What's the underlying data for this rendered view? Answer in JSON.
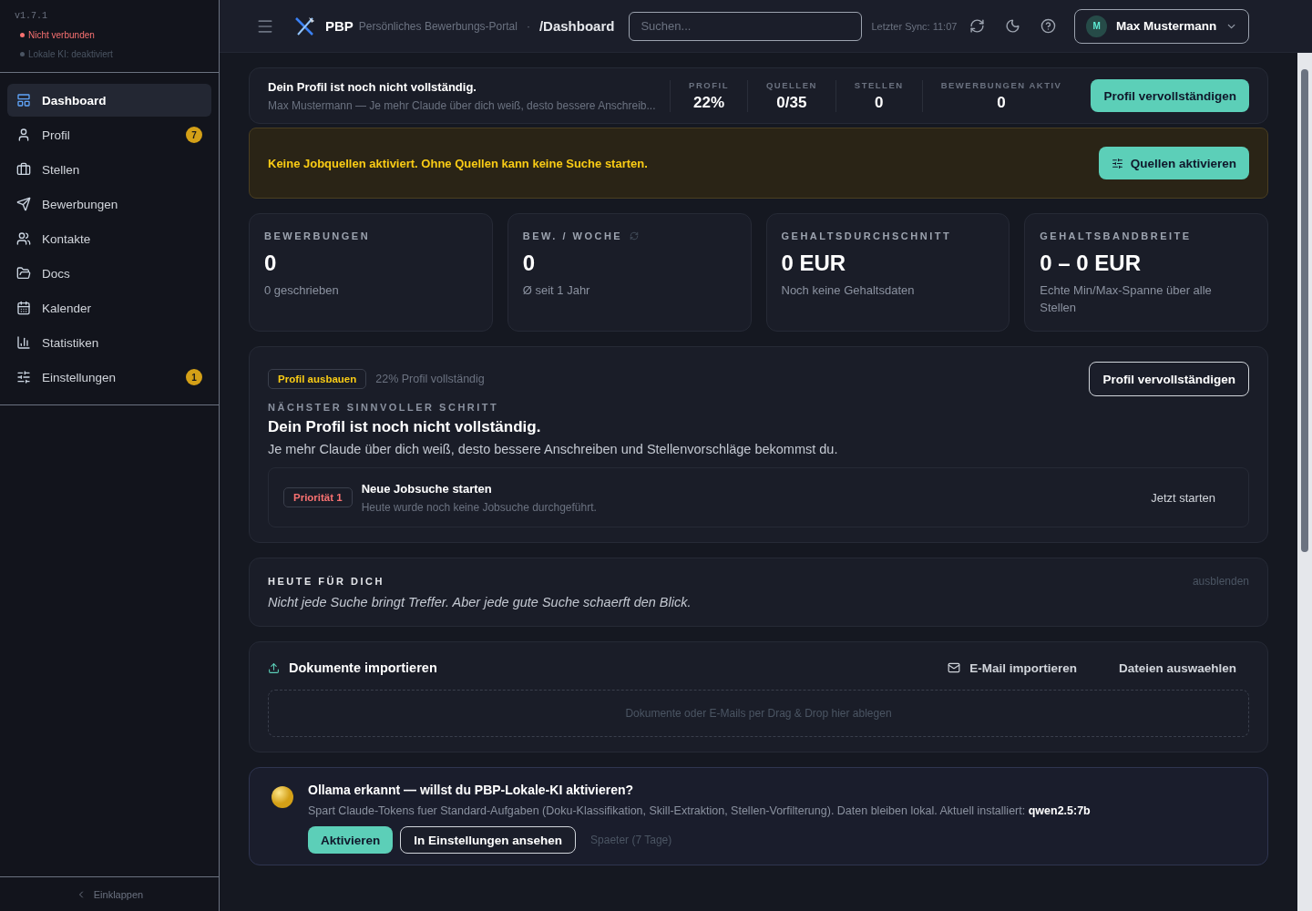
{
  "sidebar": {
    "version": "v1.7.1",
    "status": [
      {
        "label": "Nicht verbunden",
        "color": "#f87171"
      },
      {
        "label": "Lokale KI: deaktiviert",
        "color": "#4b5563"
      }
    ],
    "items": [
      {
        "label": "Dashboard",
        "selected": true
      },
      {
        "label": "Profil",
        "selected": false,
        "badge": "7"
      },
      {
        "label": "Stellen",
        "selected": false
      },
      {
        "label": "Bewerbungen",
        "selected": false
      },
      {
        "label": "Kontakte",
        "selected": false
      },
      {
        "label": "Docs",
        "selected": false
      },
      {
        "label": "Kalender",
        "selected": false
      },
      {
        "label": "Statistiken",
        "selected": false
      },
      {
        "label": "Einstellungen",
        "selected": false,
        "badge": "1"
      }
    ],
    "collapse": "Einklappen"
  },
  "header": {
    "brand": "PBP",
    "subtitle": "Persönliches Bewerbungs-Portal",
    "separator": "·",
    "path": "/Dashboard",
    "search_placeholder": "Suchen...",
    "sync": "Letzter Sync: 11:07",
    "user": {
      "initial": "M",
      "name": "Max Mustermann"
    }
  },
  "profile_banner": {
    "title": "Dein Profil ist noch nicht vollständig.",
    "text": "Max Mustermann — Je mehr Claude über dich weiß, desto bessere Anschreib...",
    "stats": [
      {
        "label": "PROFIL",
        "value": "22%"
      },
      {
        "label": "QUELLEN",
        "value": "0/35"
      },
      {
        "label": "STELLEN",
        "value": "0"
      },
      {
        "label": "BEWERBUNGEN AKTIV",
        "value": "0"
      }
    ],
    "button": "Profil vervollständigen"
  },
  "warning": {
    "text": "Keine Jobquellen aktiviert. Ohne Quellen kann keine Suche starten.",
    "button": "Quellen aktivieren"
  },
  "kpis": [
    {
      "label": "BEWERBUNGEN",
      "value": "0",
      "note": "0 geschrieben"
    },
    {
      "label": "BEW. / WOCHE",
      "value": "0",
      "note": "Ø seit 1 Jahr",
      "refresh": true
    },
    {
      "label": "GEHALTSDURCHSCHNITT",
      "value": "0 EUR",
      "note": "Noch keine Gehaltsdaten"
    },
    {
      "label": "GEHALTSBANDBREITE",
      "value": "0 – 0 EUR",
      "note": "Echte Min/Max-Spanne über alle Stellen"
    }
  ],
  "next_step": {
    "tag": "Profil ausbauen",
    "progress": "22% Profil vollständig",
    "eyebrow": "NÄCHSTER SINNVOLLER SCHRITT",
    "title": "Dein Profil ist noch nicht vollständig.",
    "text": "Je mehr Claude über dich weiß, desto bessere Anschreiben und Stellenvorschläge bekommst du.",
    "button": "Profil vervollständigen",
    "task": {
      "priority": "Priorität 1",
      "title": "Neue Jobsuche starten",
      "text": "Heute wurde noch keine Jobsuche durchgeführt.",
      "action": "Jetzt starten"
    }
  },
  "today": {
    "eyebrow": "HEUTE FÜR DICH",
    "quote": "Nicht jede Suche bringt Treffer. Aber jede gute Suche schaerft den Blick.",
    "hide": "ausblenden"
  },
  "import": {
    "title": "Dokumente importieren",
    "email": "E-Mail importieren",
    "files": "Dateien auswaehlen",
    "dropzone": "Dokumente oder E-Mails per Drag & Drop hier ablegen"
  },
  "ollama": {
    "title": "Ollama erkannt — willst du PBP-Lokale-KI aktivieren?",
    "text": "Spart Claude-Tokens fuer Standard-Aufgaben (Doku-Klassifikation, Skill-Extraktion, Stellen-Vorfilterung). Daten bleiben lokal. Aktuell installiert: **qwen2.5:7b**",
    "buttons": [
      "Aktivieren",
      "In Einstellungen ansehen"
    ],
    "later": "Spaeter (7 Tage)"
  }
}
